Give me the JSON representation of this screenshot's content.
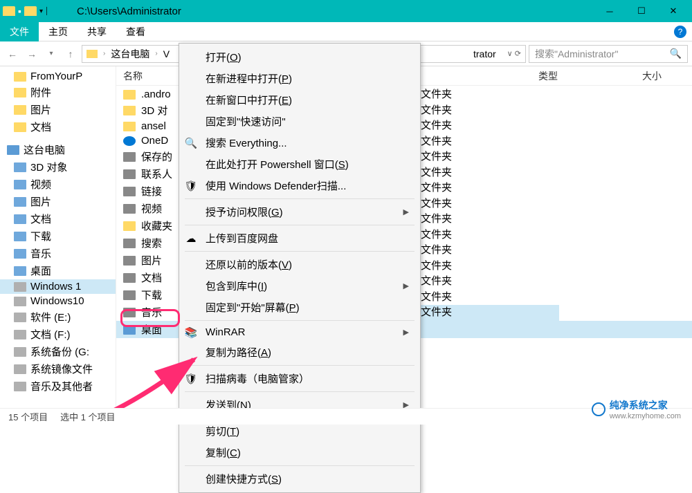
{
  "titlebar": {
    "path": "C:\\Users\\Administrator"
  },
  "ribbon": {
    "tabs": [
      "文件",
      "主页",
      "共享",
      "查看"
    ]
  },
  "navbar": {
    "breadcrumb": [
      "这台电脑",
      "V"
    ],
    "addr_tail": "trator",
    "search_placeholder": "搜索\"Administrator\""
  },
  "columns": {
    "name": "名称",
    "type": "类型",
    "size": "大小"
  },
  "sidebar": {
    "items": [
      {
        "label": "FromYourP",
        "icon": "folder"
      },
      {
        "label": "附件",
        "icon": "folder"
      },
      {
        "label": "图片",
        "icon": "folder"
      },
      {
        "label": "文档",
        "icon": "folder"
      }
    ],
    "pc_label": "这台电脑",
    "pc_items": [
      {
        "label": "3D 对象",
        "icon": "media"
      },
      {
        "label": "视频",
        "icon": "media"
      },
      {
        "label": "图片",
        "icon": "media"
      },
      {
        "label": "文档",
        "icon": "media"
      },
      {
        "label": "下载",
        "icon": "media"
      },
      {
        "label": "音乐",
        "icon": "media"
      },
      {
        "label": "桌面",
        "icon": "media"
      },
      {
        "label": "Windows 1",
        "icon": "drive",
        "selected": true
      },
      {
        "label": "Windows10",
        "icon": "drive"
      },
      {
        "label": "软件 (E:)",
        "icon": "drive"
      },
      {
        "label": "文档 (F:)",
        "icon": "drive"
      },
      {
        "label": "系统备份 (G:",
        "icon": "drive"
      },
      {
        "label": "系统镜像文件",
        "icon": "drive"
      },
      {
        "label": "音乐及其他者",
        "icon": "drive"
      }
    ]
  },
  "files": [
    {
      "name": ".andro",
      "icon": "folder",
      "type": "文件夹"
    },
    {
      "name": "3D 对",
      "icon": "folder",
      "type": "文件夹"
    },
    {
      "name": "ansel",
      "icon": "folder",
      "type": "文件夹"
    },
    {
      "name": "OneD",
      "icon": "cloud",
      "type": "文件夹"
    },
    {
      "name": "保存的",
      "icon": "cfg",
      "type": "文件夹"
    },
    {
      "name": "联系人",
      "icon": "cfg",
      "type": "文件夹"
    },
    {
      "name": "链接",
      "icon": "cfg",
      "type": "文件夹"
    },
    {
      "name": "视频",
      "icon": "cfg",
      "type": "文件夹"
    },
    {
      "name": "收藏夹",
      "icon": "folder",
      "type": "文件夹"
    },
    {
      "name": "搜索",
      "icon": "cfg",
      "type": "文件夹"
    },
    {
      "name": "图片",
      "icon": "cfg",
      "type": "文件夹"
    },
    {
      "name": "文档",
      "icon": "cfg",
      "type": "文件夹"
    },
    {
      "name": "下载",
      "icon": "cfg",
      "type": "文件夹"
    },
    {
      "name": "音乐",
      "icon": "cfg",
      "type": "文件夹"
    },
    {
      "name": "桌面",
      "icon": "desktop",
      "type": "文件夹",
      "selected": true
    }
  ],
  "ctxmenu": [
    {
      "label": "打开(O)",
      "type": "item"
    },
    {
      "label": "在新进程中打开(P)",
      "type": "item"
    },
    {
      "label": "在新窗口中打开(E)",
      "type": "item"
    },
    {
      "label": "固定到\"快速访问\"",
      "type": "item"
    },
    {
      "label": "搜索 Everything...",
      "type": "item",
      "icon": "search"
    },
    {
      "label": "在此处打开 Powershell 窗口(S)",
      "type": "item"
    },
    {
      "label": "使用 Windows Defender扫描...",
      "type": "item",
      "icon": "shield"
    },
    {
      "type": "sep"
    },
    {
      "label": "授予访问权限(G)",
      "type": "item",
      "sub": true
    },
    {
      "type": "sep"
    },
    {
      "label": "上传到百度网盘",
      "type": "item",
      "icon": "cloud"
    },
    {
      "type": "sep"
    },
    {
      "label": "还原以前的版本(V)",
      "type": "item"
    },
    {
      "label": "包含到库中(I)",
      "type": "item",
      "sub": true
    },
    {
      "label": "固定到\"开始\"屏幕(P)",
      "type": "item"
    },
    {
      "type": "sep"
    },
    {
      "label": "WinRAR",
      "type": "item",
      "icon": "rar",
      "sub": true
    },
    {
      "label": "复制为路径(A)",
      "type": "item"
    },
    {
      "type": "sep"
    },
    {
      "label": "扫描病毒（电脑管家）",
      "type": "item",
      "icon": "qq"
    },
    {
      "type": "sep"
    },
    {
      "label": "发送到(N)",
      "type": "item",
      "sub": true
    },
    {
      "type": "sep"
    },
    {
      "label": "剪切(T)",
      "type": "item"
    },
    {
      "label": "复制(C)",
      "type": "item"
    },
    {
      "type": "sep"
    },
    {
      "label": "创建快捷方式(S)",
      "type": "item"
    }
  ],
  "statusbar": {
    "count": "15 个项目",
    "selected": "选中 1 个项目"
  },
  "watermark": {
    "text": "纯净系统之家",
    "url": "www.kzmyhome.com"
  }
}
